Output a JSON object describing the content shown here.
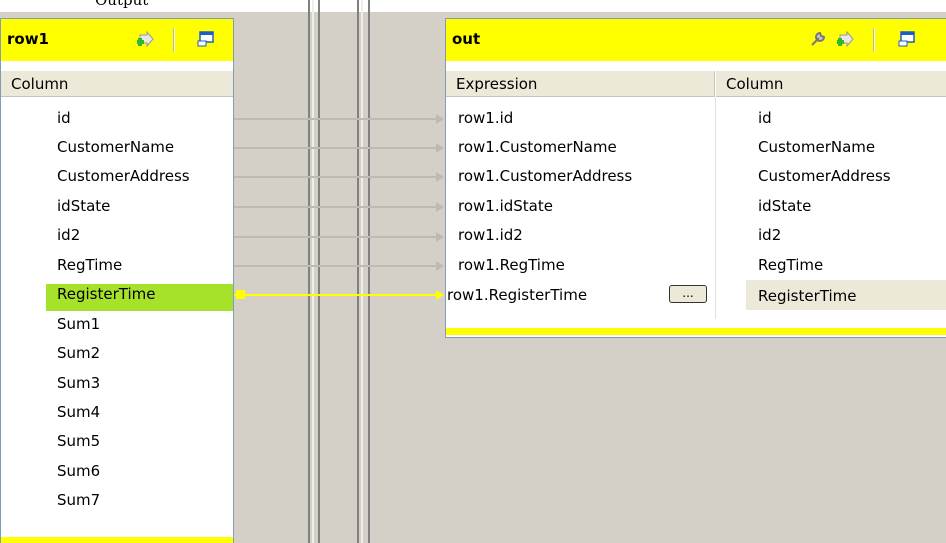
{
  "top_text": "Output",
  "left_table": {
    "title": "row1",
    "column_header": "Column",
    "rows": [
      "id",
      "CustomerName",
      "CustomerAddress",
      "idState",
      "id2",
      "RegTime",
      "RegisterTime",
      "Sum1",
      "Sum2",
      "Sum3",
      "Sum4",
      "Sum5",
      "Sum6",
      "Sum7"
    ]
  },
  "right_table": {
    "title": "out",
    "expression_header": "Expression",
    "column_header": "Column",
    "rows": [
      {
        "expr": "row1.id",
        "col": "id"
      },
      {
        "expr": "row1.CustomerName",
        "col": "CustomerName"
      },
      {
        "expr": "row1.CustomerAddress",
        "col": "CustomerAddress"
      },
      {
        "expr": "row1.idState",
        "col": "idState"
      },
      {
        "expr": "row1.id2",
        "col": "id2"
      },
      {
        "expr": "row1.RegTime",
        "col": "RegTime"
      },
      {
        "expr": "row1.RegisterTime",
        "col": "RegisterTime"
      }
    ],
    "expression_button_label": "..."
  },
  "colors": {
    "title_bar": "#ffff00",
    "selected_row": "#a6e22a",
    "link_selected": "#ffff00"
  }
}
